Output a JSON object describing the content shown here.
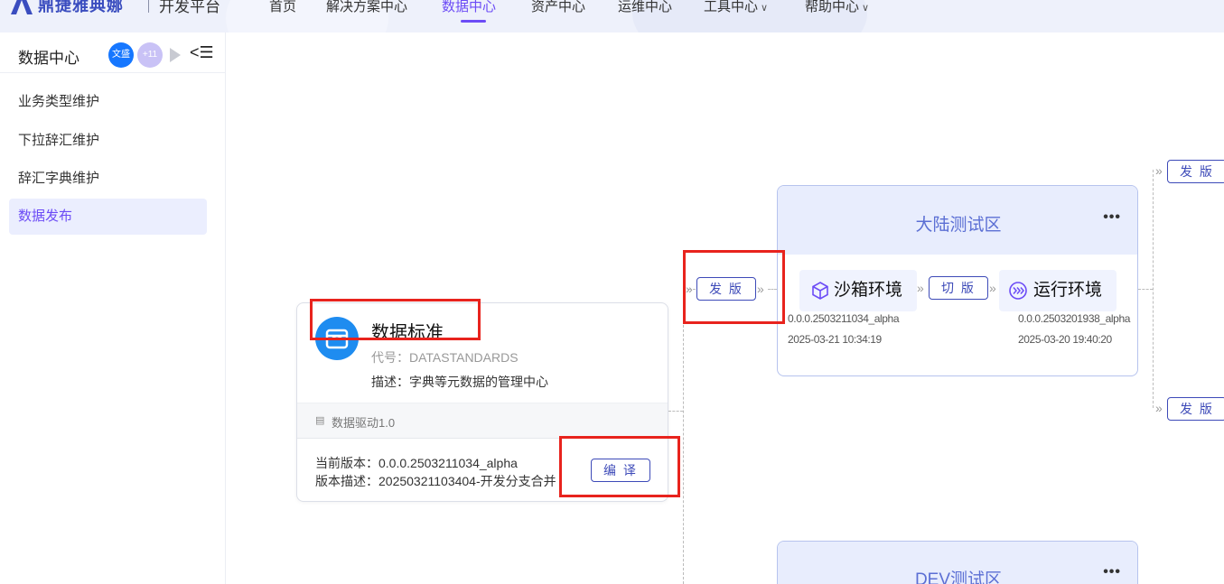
{
  "app": {
    "brand": "鼎捷雅典娜",
    "subtitle": "开发平台"
  },
  "nav": {
    "items": [
      {
        "label": "首页",
        "active": false
      },
      {
        "label": "解决方案中心",
        "active": false
      },
      {
        "label": "数据中心",
        "active": true
      },
      {
        "label": "资产中心",
        "active": false
      },
      {
        "label": "运维中心",
        "active": false
      },
      {
        "label": "工具中心",
        "active": false,
        "dropdown": true
      },
      {
        "label": "帮助中心",
        "active": false,
        "dropdown": true
      }
    ],
    "dropdown_glyph": "∨"
  },
  "sidebar": {
    "title": "数据中心",
    "avatar_user": "文盛",
    "avatar_more": "+11",
    "collapse_glyph": "<☰",
    "items": [
      {
        "label": "业务类型维护",
        "active": false
      },
      {
        "label": "下拉辞汇维护",
        "active": false
      },
      {
        "label": "辞汇字典维护",
        "active": false
      },
      {
        "label": "数据发布",
        "active": true
      }
    ]
  },
  "source_card": {
    "title": "数据标准",
    "code": "代号：DATASTANDARDS",
    "description": "描述：字典等元数据的管理中心",
    "driver": "数据驱动1.0",
    "current_version": "当前版本：0.0.0.2503211034_alpha",
    "version_description": "版本描述：20250321103404-开发分支合并",
    "compile_button": "编 译"
  },
  "release_button": "发 版",
  "switch_button": "切 版",
  "branch_release_top": "发 版",
  "branch_release_bottom": "发 版",
  "env_main": {
    "title": "大陆测试区",
    "more": "•••",
    "sandbox": {
      "label": "沙箱环境",
      "version": "0.0.0.2503211034_alpha",
      "time": "2025-03-21 10:34:19"
    },
    "runtime": {
      "label": "运行环境",
      "version": "0.0.0.2503201938_alpha",
      "time": "2025-03-20 19:40:20"
    }
  },
  "env_dev": {
    "title": "DEV测试区",
    "more": "•••"
  },
  "colors": {
    "accent": "#6c4cf6",
    "brand_blue": "#3d4ab8",
    "highlight_red": "#e8231d",
    "env_header": "#e8edfd"
  }
}
